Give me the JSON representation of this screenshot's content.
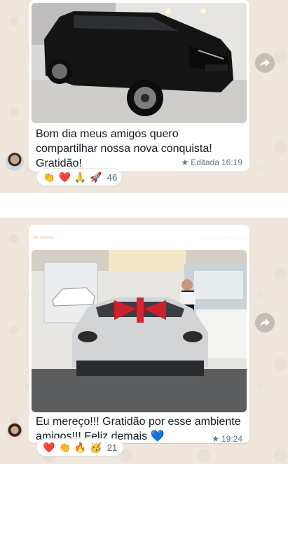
{
  "messages": [
    {
      "text": "Bom dia meus amigos quero compartilhar nossa nova conquista! Gratidão!",
      "edited_label": "Editada",
      "time": "16:19",
      "starred": true,
      "image": "photo-black-suv",
      "reactions": [
        "👏",
        "❤️",
        "🙏",
        "🚀"
      ],
      "reaction_count": "46"
    },
    {
      "text": "Eu mereço!!! Gratidão por esse ambiente amigos!!! Feliz demais 💙",
      "time": "19:24",
      "starred": true,
      "image": "photo-white-porsche-showroom",
      "reactions": [
        "❤️",
        "👏",
        "🔥",
        "🥳"
      ],
      "reaction_count": "21"
    }
  ],
  "icons": {
    "forward": "forward-icon",
    "star": "star-icon"
  },
  "colors": {
    "chat_background": "#efe7dd",
    "bubble": "#ffffff",
    "meta_text": "#667781"
  }
}
